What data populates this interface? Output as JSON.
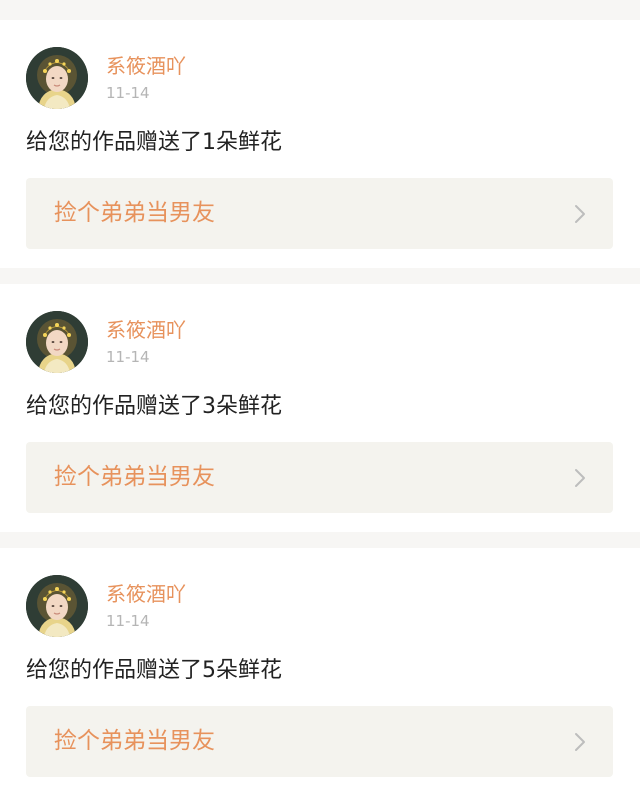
{
  "colors": {
    "page_background": "#f7f6f4",
    "card_background": "#ffffff",
    "accent": "#e7925c",
    "date_text": "#b5b5b5",
    "body_text": "#222222",
    "link_box": "#f4f3ee",
    "chevron": "#bdbdbd"
  },
  "notifications": [
    {
      "username": "系筱酒吖",
      "date": "11-14",
      "message": "给您的作品赠送了1朵鲜花",
      "work_title": "捡个弟弟当男友",
      "avatar_icon": "user-avatar-icon",
      "link_icon": "chevron-right-icon"
    },
    {
      "username": "系筱酒吖",
      "date": "11-14",
      "message": "给您的作品赠送了3朵鲜花",
      "work_title": "捡个弟弟当男友",
      "avatar_icon": "user-avatar-icon",
      "link_icon": "chevron-right-icon"
    },
    {
      "username": "系筱酒吖",
      "date": "11-14",
      "message": "给您的作品赠送了5朵鲜花",
      "work_title": "捡个弟弟当男友",
      "avatar_icon": "user-avatar-icon",
      "link_icon": "chevron-right-icon"
    }
  ]
}
